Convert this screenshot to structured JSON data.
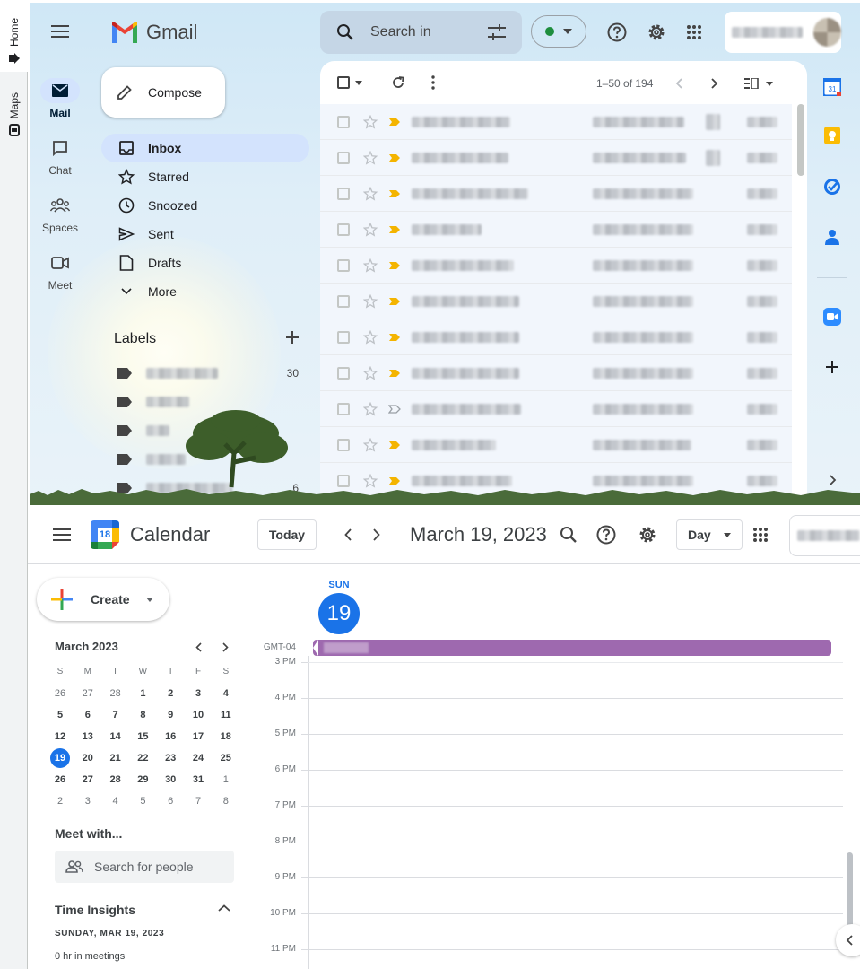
{
  "browser_tabs": [
    {
      "label": "Home"
    },
    {
      "label": "Maps"
    }
  ],
  "gmail": {
    "logo_text": "Gmail",
    "search": {
      "placeholder": "Search in"
    },
    "rail": [
      {
        "label": "Mail"
      },
      {
        "label": "Chat"
      },
      {
        "label": "Spaces"
      },
      {
        "label": "Meet"
      }
    ],
    "compose_label": "Compose",
    "nav": [
      {
        "label": "Inbox"
      },
      {
        "label": "Starred"
      },
      {
        "label": "Snoozed"
      },
      {
        "label": "Sent"
      },
      {
        "label": "Drafts"
      },
      {
        "label": "More"
      }
    ],
    "labels_heading": "Labels",
    "labels": [
      {
        "count": "30"
      },
      {
        "count": ""
      },
      {
        "count": ""
      },
      {
        "count": ""
      },
      {
        "count": "6"
      }
    ],
    "pagination": "1–50 of 194"
  },
  "calendar": {
    "app_name": "Calendar",
    "logo_day": "18",
    "today_label": "Today",
    "date_title": "March 19, 2023",
    "view_select": "Day",
    "create_label": "Create",
    "mini_month": "March 2023",
    "weekdays": [
      "S",
      "M",
      "T",
      "W",
      "T",
      "F",
      "S"
    ],
    "weeks": [
      [
        "26",
        "27",
        "28",
        "1",
        "2",
        "3",
        "4"
      ],
      [
        "5",
        "6",
        "7",
        "8",
        "9",
        "10",
        "11"
      ],
      [
        "12",
        "13",
        "14",
        "15",
        "16",
        "17",
        "18"
      ],
      [
        "19",
        "20",
        "21",
        "22",
        "23",
        "24",
        "25"
      ],
      [
        "26",
        "27",
        "28",
        "29",
        "30",
        "31",
        "1"
      ],
      [
        "2",
        "3",
        "4",
        "5",
        "6",
        "7",
        "8"
      ]
    ],
    "meet_with": "Meet with...",
    "search_people_placeholder": "Search for people",
    "time_insights": "Time Insights",
    "insights_date": "SUNDAY, MAR 19, 2023",
    "insights_meetings": "0 hr in meetings",
    "day_header": {
      "weekday": "SUN",
      "day": "19"
    },
    "timezone": "GMT-04",
    "hours": [
      "3 PM",
      "4 PM",
      "5 PM",
      "6 PM",
      "7 PM",
      "8 PM",
      "9 PM",
      "10 PM",
      "11 PM"
    ],
    "event_color": "#9e69af"
  },
  "colors": {
    "accent": "#1a73e8",
    "gmail_selected": "#d3e3fd"
  }
}
